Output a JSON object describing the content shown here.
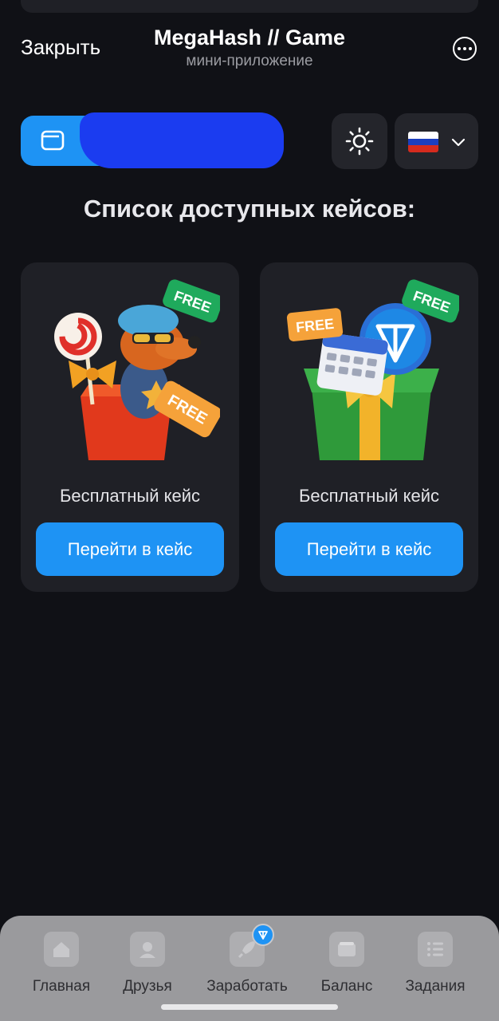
{
  "header": {
    "close_label": "Закрыть",
    "title": "MegaHash // Game",
    "subtitle": "мини-приложение",
    "more_icon": "ellipsis-circle-icon"
  },
  "toolbar": {
    "wallet_icon": "wallet-icon",
    "theme_icon": "sun-icon",
    "language_flag": "russia-flag-icon",
    "language_chevron": "chevron-down-icon"
  },
  "main": {
    "section_title": "Список доступных кейсов:",
    "cases": [
      {
        "badge": "FREE",
        "art_badge": "FREE",
        "name": "Бесплатный кейс",
        "button_label": "Перейти в кейс"
      },
      {
        "badge": "FREE",
        "art_badge": "FREE",
        "name": "Бесплатный кейс",
        "button_label": "Перейти в кейс"
      }
    ]
  },
  "tabbar": {
    "items": [
      {
        "label": "Главная",
        "icon": "home-icon"
      },
      {
        "label": "Друзья",
        "icon": "user-icon"
      },
      {
        "label": "Заработать",
        "icon": "rocket-icon",
        "badge_icon": "ton-icon"
      },
      {
        "label": "Баланс",
        "icon": "wallet-icon"
      },
      {
        "label": "Задания",
        "icon": "list-icon"
      }
    ]
  },
  "colors": {
    "background": "#101116",
    "card": "#1f2026",
    "accent": "#1e93f4",
    "free_badge": "#1faa5c"
  }
}
